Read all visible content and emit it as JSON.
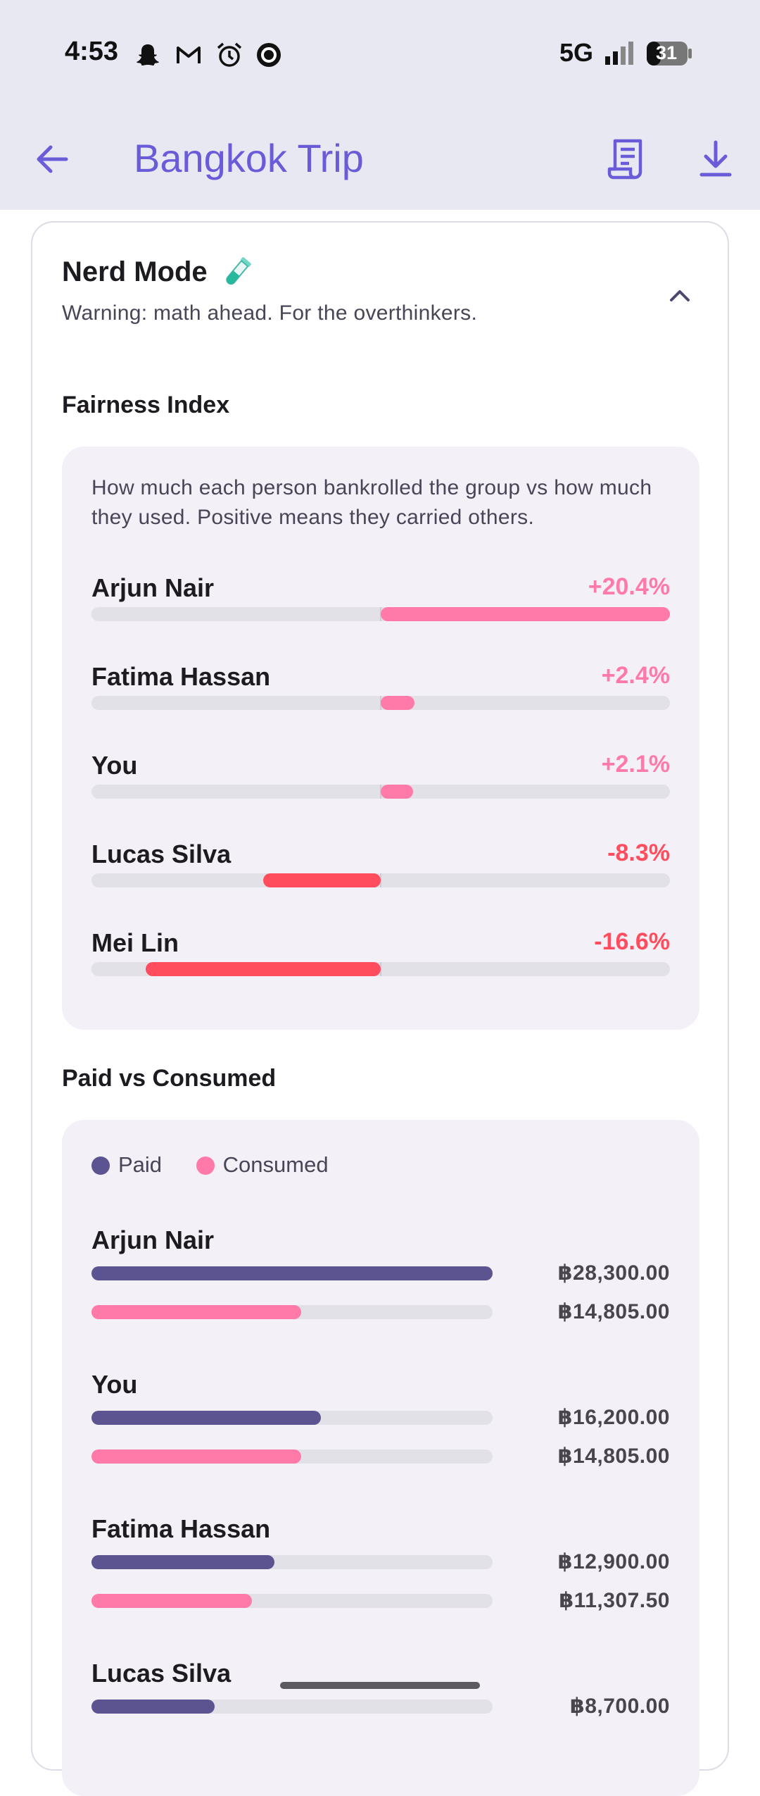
{
  "status_bar": {
    "time": "4:53",
    "network": "5G",
    "battery": "31",
    "icons": [
      "snapchat-icon",
      "gmail-icon",
      "alarm-icon",
      "record-icon",
      "signal-icon",
      "battery-icon"
    ]
  },
  "app_bar": {
    "title": "Bangkok Trip",
    "icons": [
      "back-arrow-icon",
      "receipt-icon",
      "download-icon"
    ],
    "accent_color": "#6a5bd9"
  },
  "nerd_mode": {
    "title": "Nerd Mode",
    "subtitle": "Warning: math ahead. For the overthinkers.",
    "expanded": true
  },
  "fairness_index": {
    "title": "Fairness Index",
    "description": "How much each person bankrolled the group vs how much they used. Positive means they carried others.",
    "positive_color": "#ff7aa8",
    "negative_color": "#ff4d5e",
    "rows": [
      {
        "name": "Arjun Nair",
        "value": "+20.4%",
        "percent": 20.4
      },
      {
        "name": "Fatima Hassan",
        "value": "+2.4%",
        "percent": 2.4
      },
      {
        "name": "You",
        "value": "+2.1%",
        "percent": 2.1
      },
      {
        "name": "Lucas Silva",
        "value": "-8.3%",
        "percent": -8.3
      },
      {
        "name": "Mei Lin",
        "value": "-16.6%",
        "percent": -16.6
      }
    ]
  },
  "paid_vs_consumed": {
    "title": "Paid vs Consumed",
    "legend": {
      "paid": "Paid",
      "consumed": "Consumed"
    },
    "paid_color": "#5b5490",
    "consumed_color": "#ff7aa8",
    "max_amount": 28300,
    "rows": [
      {
        "name": "Arjun Nair",
        "paid_label": "฿28,300.00",
        "paid": 28300,
        "consumed_label": "฿14,805.00",
        "consumed": 14805
      },
      {
        "name": "You",
        "paid_label": "฿16,200.00",
        "paid": 16200,
        "consumed_label": "฿14,805.00",
        "consumed": 14805
      },
      {
        "name": "Fatima Hassan",
        "paid_label": "฿12,900.00",
        "paid": 12900,
        "consumed_label": "฿11,307.50",
        "consumed": 11307.5
      },
      {
        "name": "Lucas Silva",
        "paid_label": "฿8,700.00",
        "paid": 8700,
        "consumed_label": "",
        "consumed": null
      }
    ]
  }
}
